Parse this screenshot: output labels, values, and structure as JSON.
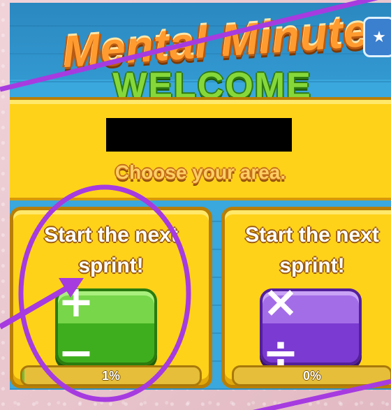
{
  "game": {
    "title": "Mental Minute",
    "star_icon": "star-icon",
    "welcome": "WELCOME",
    "player_name_redacted": true,
    "subtitle": "Choose your area."
  },
  "areas": [
    {
      "label": "Start the next\nsprint!",
      "operation_icon": "plus-minus-icon",
      "operations": "+ −",
      "progress_text": "1%",
      "progress_value": 0.01,
      "color": "#3fae1e"
    },
    {
      "label": "Start the next\nsprint!",
      "operation_icon": "times-divide-icon",
      "operations": "× ÷",
      "progress_text": "0%",
      "progress_value": 0.0,
      "color": "#7b3ad1"
    }
  ],
  "annotation": {
    "color": "#a63be0",
    "marks": [
      "circle-highlight",
      "arrow-pointer",
      "diagonal-lines"
    ]
  }
}
